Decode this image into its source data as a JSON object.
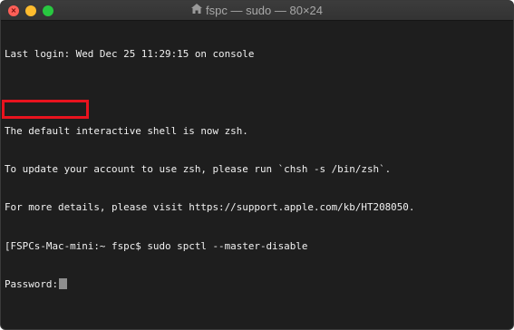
{
  "window": {
    "title": "fspc — sudo — 80×24",
    "title_icon": "home-folder-icon",
    "traffic_lights": {
      "close_color": "#ff5f57",
      "minimize_color": "#febc2e",
      "maximize_color": "#28c840"
    }
  },
  "terminal": {
    "lines": [
      "Last login: Wed Dec 25 11:29:15 on console",
      "",
      "The default interactive shell is now zsh.",
      "To update your account to use zsh, please run `chsh -s /bin/zsh`.",
      "For more details, please visit https://support.apple.com/kb/HT208050.",
      "[FSPCs-Mac-mini:~ fspc$ sudo spctl --master-disable"
    ],
    "password_prompt": "Password:",
    "highlight_color": "#e8131e"
  }
}
